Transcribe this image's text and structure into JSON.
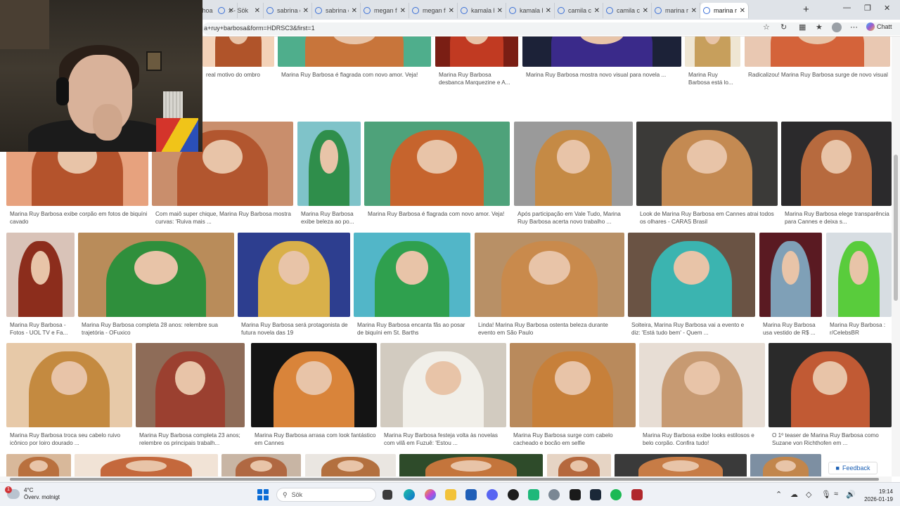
{
  "browser": {
    "tabs": [
      {
        "label": "lana rhoa"
      },
      {
        "label": "x - Sök"
      },
      {
        "label": "sabrina c"
      },
      {
        "label": "sabrina c"
      },
      {
        "label": "megan f"
      },
      {
        "label": "megan f"
      },
      {
        "label": "kamala h"
      },
      {
        "label": "kamala h"
      },
      {
        "label": "camila c"
      },
      {
        "label": "camila c"
      },
      {
        "label": "marina r"
      },
      {
        "label": "marina r"
      }
    ],
    "address": "a+ruy+barbosa&form=HDRSC3&first=1",
    "copilot_label": "Chatt",
    "feedback_label": "Feedback"
  },
  "results": [
    {
      "caption": "real motivo do ombro",
      "colors": [
        "#f3d2b8",
        "#b0542a"
      ]
    },
    {
      "caption": "Marina Ruy Barbosa é flagrada com novo amor. Veja!",
      "colors": [
        "#4fae8c",
        "#c8753b"
      ]
    },
    {
      "caption": "Marina Ruy Barbosa desbanca Marquezine e A...",
      "colors": [
        "#7a1e14",
        "#c13a22"
      ]
    },
    {
      "caption": "Marina Ruy Barbosa mostra novo visual para novela ...",
      "colors": [
        "#1c2238",
        "#3a2a8a"
      ]
    },
    {
      "caption": "Marina Ruy Barbosa está lo...",
      "colors": [
        "#efe6d3",
        "#c79f5c"
      ]
    },
    {
      "caption": "Radicalizou! Marina Ruy Barbosa surge de novo visual",
      "colors": [
        "#e9c8b2",
        "#d4633a"
      ]
    },
    {
      "caption": "Marina Ruy Barbosa exibe corpão em fotos de biquíni cavado",
      "colors": [
        "#e7a27e",
        "#b4532c"
      ]
    },
    {
      "caption": "Com maiô super chique, Marina Ruy Barbosa mostra curvas: 'Ruiva mais ...",
      "colors": [
        "#c98e6c",
        "#b2562f"
      ]
    },
    {
      "caption": "Marina Ruy Barbosa exibe beleza ao po...",
      "colors": [
        "#7fc3c9",
        "#2f8e4b"
      ]
    },
    {
      "caption": "Marina Ruy Barbosa é flagrada com novo amor. Veja!",
      "colors": [
        "#4ea27a",
        "#c6642d"
      ]
    },
    {
      "caption": "Após participação em Vale Tudo, Marina Ruy Barbosa acerta novo trabalho ...",
      "colors": [
        "#9a9a9a",
        "#c58a45"
      ]
    },
    {
      "caption": "Look de Marina Ruy Barbosa em Cannes atrai todos os olhares - CARAS Brasil",
      "colors": [
        "#3b3a38",
        "#c48a52"
      ]
    },
    {
      "caption": "Marina Ruy Barbosa elege transparência para Cannes e deixa s...",
      "colors": [
        "#2b2a2c",
        "#b76a3e"
      ]
    },
    {
      "caption": "Marina Ruy Barbosa - Fotos - UOL TV e Fa...",
      "colors": [
        "#d9c3b8",
        "#8c2d1c"
      ]
    },
    {
      "caption": "Marina Ruy Barbosa completa 28 anos: relembre sua trajetória - OFuxico",
      "colors": [
        "#b98c5a",
        "#2f8f3c"
      ]
    },
    {
      "caption": "Marina Ruy Barbosa será protagonista de futura novela das 19",
      "colors": [
        "#2d3e8f",
        "#d9b04a"
      ]
    },
    {
      "caption": "Marina Ruy Barbosa encanta fãs ao posar de biquíni em St. Barths",
      "colors": [
        "#52b6c8",
        "#2fa04e"
      ]
    },
    {
      "caption": "Linda! Marina Ruy Barbosa ostenta beleza durante evento em São Paulo",
      "colors": [
        "#b89066",
        "#c98a4c"
      ]
    },
    {
      "caption": "Solteira, Marina Ruy Barbosa vai a evento e diz: 'Está tudo bem' - Quem ...",
      "colors": [
        "#6a5344",
        "#3bb4b0"
      ]
    },
    {
      "caption": "Marina Ruy Barbosa usa vestido de R$ ...",
      "colors": [
        "#5a1a22",
        "#7fa0b7"
      ]
    },
    {
      "caption": "Marina Ruy Barbosa : r/CelebsBR",
      "colors": [
        "#d7dde2",
        "#59cc3c"
      ]
    },
    {
      "caption": "Marina Ruy Barbosa troca seu cabelo ruivo icônico por loiro dourado ...",
      "colors": [
        "#e7c9a8",
        "#c48a40"
      ]
    },
    {
      "caption": "Marina Ruy Barbosa completa 23 anos; relembre os principais trabalh...",
      "colors": [
        "#8e6c58",
        "#9b4030"
      ]
    },
    {
      "caption": "Marina Ruy Barbosa arrasa com look fantástico em Cannes",
      "colors": [
        "#141414",
        "#d9843a"
      ]
    },
    {
      "caption": "Marina Ruy Barbosa festeja volta às novelas com vilã em Fuzuê: 'Estou ...",
      "colors": [
        "#d2cbc0",
        "#f1efe9"
      ]
    },
    {
      "caption": "Marina Ruy Barbosa surge com cabelo cacheado e bocão em selfie",
      "colors": [
        "#b98a5c",
        "#c7803a"
      ]
    },
    {
      "caption": "Marina Ruy Barbosa exibe looks estilosos e belo corpão. Confira tudo!",
      "colors": [
        "#e7ddd4",
        "#c79a72"
      ]
    },
    {
      "caption": "O 1º teaser de Marina Ruy Barbosa como Suzane von Richthofen em ...",
      "colors": [
        "#2a2a2a",
        "#c15a34"
      ]
    },
    {
      "caption": "",
      "colors": [
        "#d8b89a",
        "#b9703e"
      ]
    },
    {
      "caption": "",
      "colors": [
        "#f1e3d6",
        "#c4683c"
      ]
    },
    {
      "caption": "",
      "colors": [
        "#c8b5a4",
        "#b06842"
      ]
    },
    {
      "caption": "",
      "colors": [
        "#eae6e1",
        "#b3703f"
      ]
    },
    {
      "caption": "",
      "colors": [
        "#2e4b2a",
        "#c4753c"
      ]
    },
    {
      "caption": "",
      "colors": [
        "#e6d4c4",
        "#b5683d"
      ]
    },
    {
      "caption": "",
      "colors": [
        "#3a3a3a",
        "#c77c46"
      ]
    },
    {
      "caption": "",
      "colors": [
        "#7d8fa2",
        "#c2864c"
      ]
    }
  ],
  "taskbar": {
    "weather_temp": "4°C",
    "weather_text": "Överv. molnigt",
    "weather_badge": "1",
    "search_label": "Sök",
    "time": "19:14",
    "date": "2026-01-19"
  }
}
